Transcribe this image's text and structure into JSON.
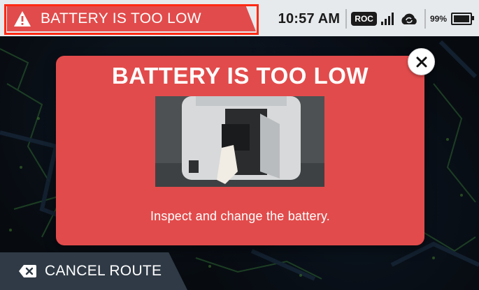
{
  "alert": {
    "title": "BATTERY IS TOO LOW",
    "icon": "warning-triangle-icon"
  },
  "status": {
    "time": "10:57 AM",
    "mode_badge": "ROC",
    "battery_percent": "99%",
    "signal_level": 4
  },
  "modal": {
    "title": "BATTERY IS TOO LOW",
    "message": "Inspect and change the battery.",
    "close_icon": "close-icon"
  },
  "cancel": {
    "label": "CANCEL ROUTE",
    "icon": "delete-backspace-icon"
  },
  "colors": {
    "alert_red": "#e24b4b",
    "highlight_border": "#ff2a14",
    "cancel_bg": "#2f3a46",
    "status_bar_bg": "#e7eaed"
  }
}
